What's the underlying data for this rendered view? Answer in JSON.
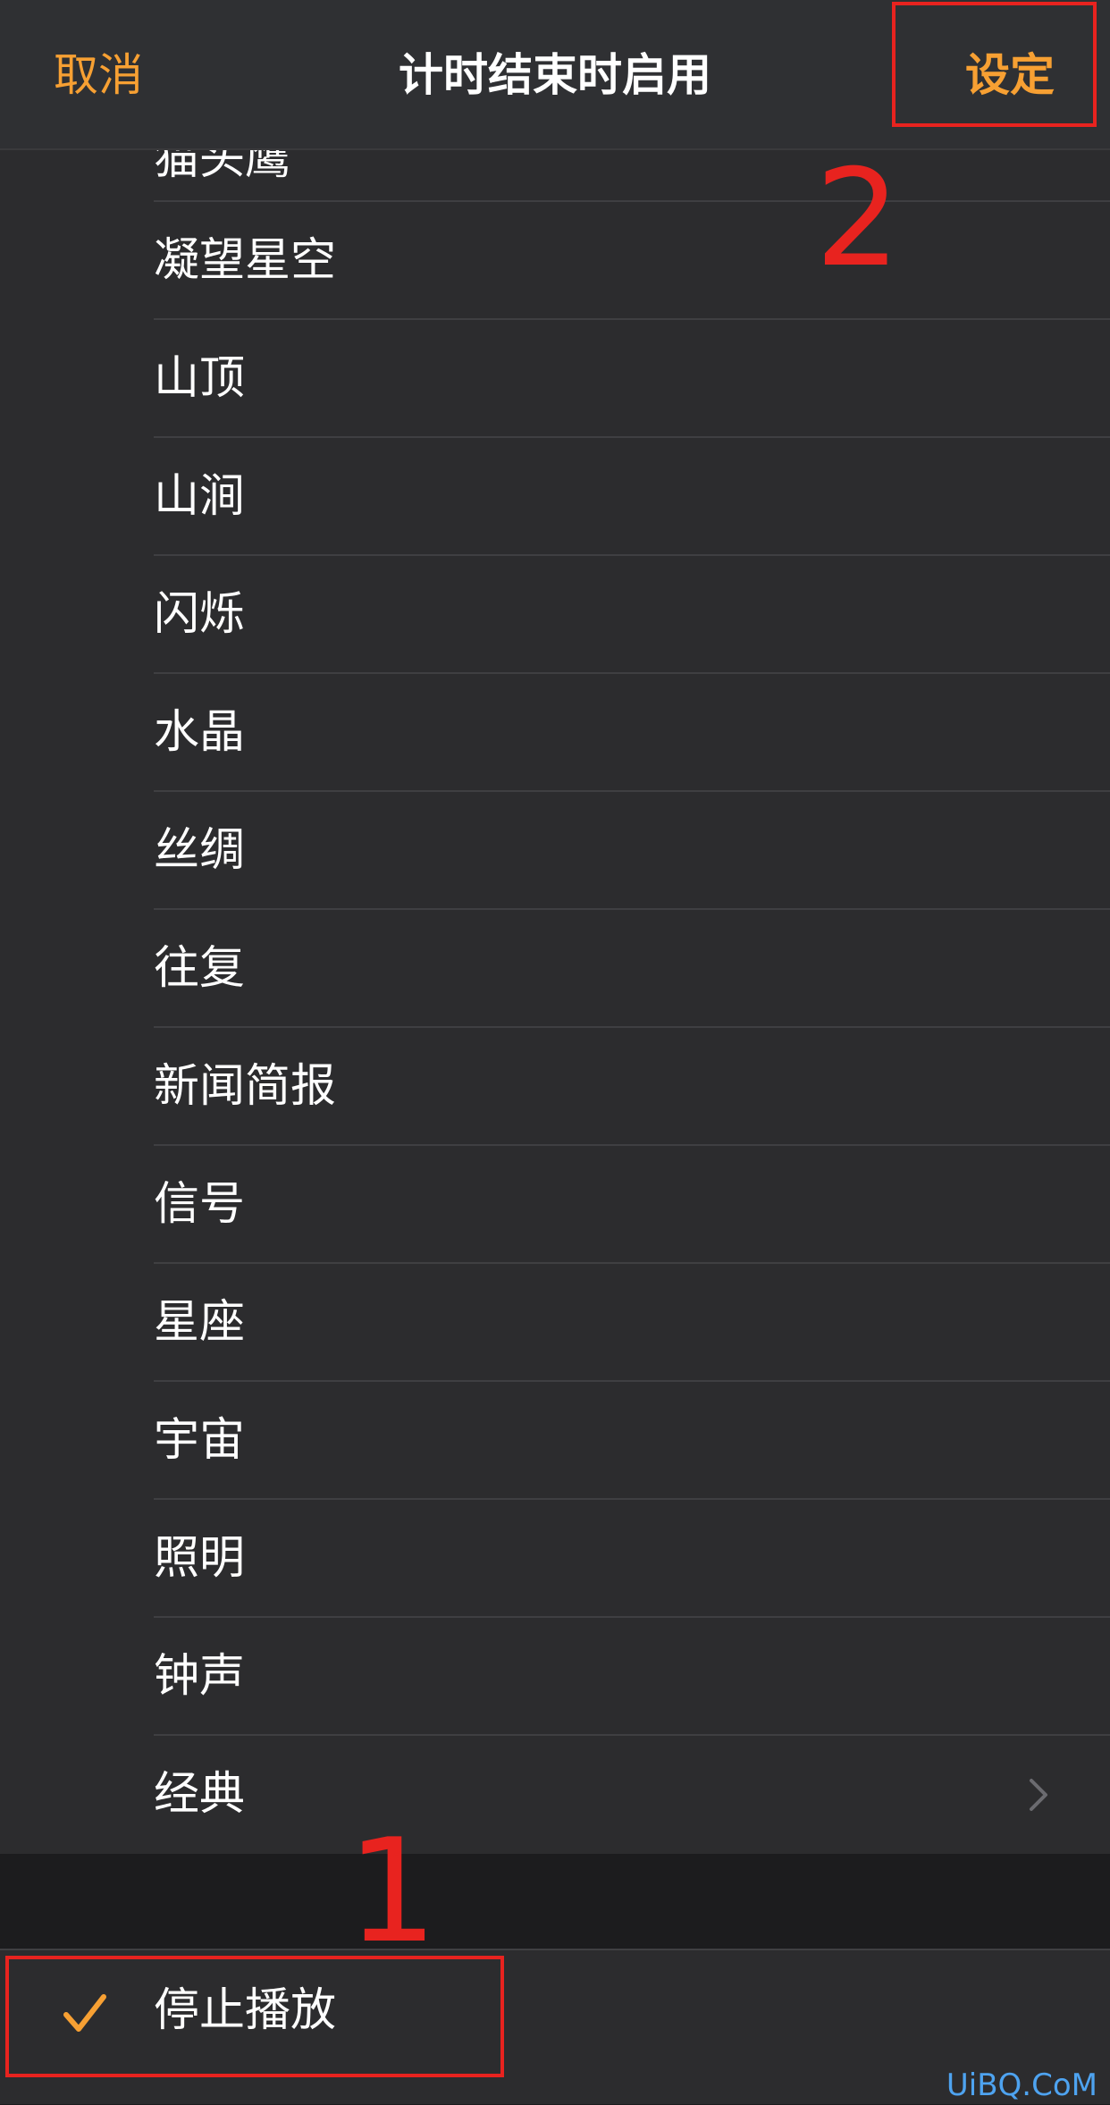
{
  "nav": {
    "cancel_label": "取消",
    "title": "计时结束时启用",
    "set_label": "设定"
  },
  "ringtones": [
    "猫头鹰",
    "凝望星空",
    "山顶",
    "山涧",
    "闪烁",
    "水晶",
    "丝绸",
    "往复",
    "新闻简报",
    "信号",
    "星座",
    "宇宙",
    "照明",
    "钟声",
    "经典"
  ],
  "stop_option": {
    "label": "停止播放",
    "selected": true
  },
  "annotations": {
    "step_one": "1",
    "step_two": "2"
  },
  "watermark": "UiBQ.CoM",
  "colors": {
    "accent": "#f7a033",
    "annotation": "#e8231f",
    "background": "#1c1c1e",
    "cell": "#2c2c2e",
    "watermark": "#4ea3f0"
  }
}
